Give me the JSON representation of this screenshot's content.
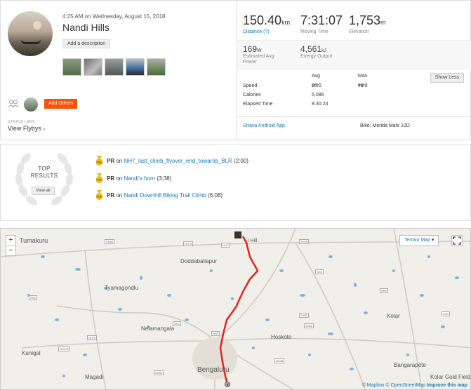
{
  "activity": {
    "datetime": "4:25 AM on Wednesday, August 15, 2018",
    "title": "Nandi Hills",
    "add_description": "Add a description",
    "add_others": "Add Others",
    "strava_labs": "STRAVA LABS",
    "view_flybys": "View Flybys"
  },
  "stats": {
    "distance": {
      "value": "150.40",
      "unit": "km",
      "label": "Distance (?)"
    },
    "moving_time": {
      "value": "7:31:07",
      "label": "Moving Time"
    },
    "elevation": {
      "value": "1,753",
      "unit": "m",
      "label": "Elevation"
    },
    "power": {
      "value": "169",
      "unit": "W",
      "label": "Estimated Avg Power"
    },
    "energy": {
      "value": "4,561",
      "unit": "kJ",
      "label": "Energy Output"
    }
  },
  "details": {
    "header_avg": "Avg",
    "header_max": "Max",
    "show_less": "Show Less",
    "rows": [
      {
        "name": "Speed",
        "avg": "20.0",
        "avg_unit": "km/h",
        "max": "49.3",
        "max_unit": "km/h"
      },
      {
        "name": "Calories",
        "avg": "5,086",
        "max": ""
      },
      {
        "name": "Elapsed Time",
        "avg": "8:30:24",
        "max": ""
      }
    ],
    "device": "Strava Android App",
    "bike": "Bike: Merida Mats 10D"
  },
  "top_results": {
    "title_line1": "TOP",
    "title_line2": "RESULTS",
    "view_all": "View all",
    "items": [
      {
        "pr": "PR",
        "on": "on",
        "segment": "NH7_last_climb_flyover_end_towards_BLR",
        "time": "(2:00)"
      },
      {
        "pr": "PR",
        "on": "on",
        "segment": "Nandi's horn",
        "time": "(3:38)"
      },
      {
        "pr": "PR",
        "on": "on",
        "segment": "Nandi Downhill Biking Trail Climb",
        "time": "(6:08)"
      }
    ]
  },
  "map": {
    "terrain_button": "Terrain Map",
    "zoom_in": "+",
    "zoom_out": "−",
    "places": {
      "tumakuru": "Tumakuru",
      "doddaballapur": "Doddaballapur",
      "tyamagondlu": "Tyamagondlu",
      "nelamangala": "Nelamangala",
      "hoskote": "Hoskote",
      "kolar": "Kolar",
      "kunigal": "Kunigal",
      "magadi": "Magadi",
      "bengaluru": "Bengaluru",
      "bangarapete": "Bangarapete",
      "kgf": "Kolar Gold Fields",
      "hill": "i Hill"
    },
    "roads": [
      "SH84",
      "NH75",
      "NH7",
      "SH35",
      "SH3",
      "SH5",
      "SH82",
      "NH4",
      "NH75",
      "SH82",
      "SH3",
      "SH86",
      "NH275",
      "SH3",
      "SH4",
      "NH48"
    ],
    "attribution_mapbox": "© Mapbox",
    "attribution_osm": "© OpenStreetMap",
    "improve": "Improve this map"
  },
  "colors": {
    "accent": "#fc5200",
    "link": "#1478b8",
    "route": "#e8201e"
  }
}
